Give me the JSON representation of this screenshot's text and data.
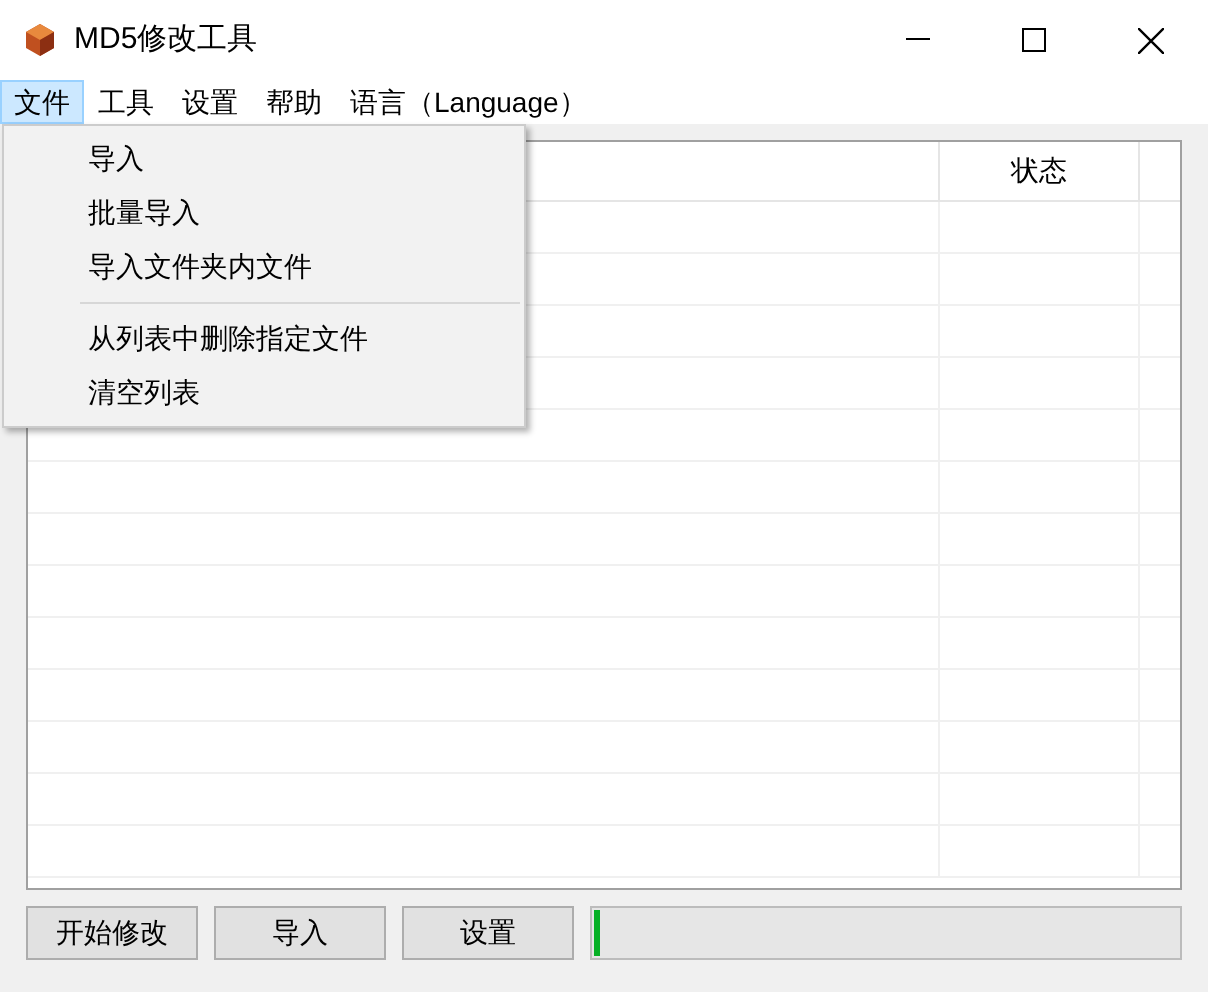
{
  "window": {
    "title": "MD5修改工具"
  },
  "menu_bar": [
    {
      "label": "文件",
      "selected": true
    },
    {
      "label": "工具",
      "selected": false
    },
    {
      "label": "设置",
      "selected": false
    },
    {
      "label": "帮助",
      "selected": false
    },
    {
      "label": "语言（Language）",
      "selected": false
    }
  ],
  "dropdown": [
    {
      "kind": "item",
      "label": "导入"
    },
    {
      "kind": "item",
      "label": "批量导入"
    },
    {
      "kind": "item",
      "label": "导入文件夹内文件"
    },
    {
      "kind": "separator"
    },
    {
      "kind": "item",
      "label": "从列表中删除指定文件"
    },
    {
      "kind": "item",
      "label": "清空列表"
    }
  ],
  "table": {
    "columns": [
      "状态"
    ]
  },
  "buttons": [
    "开始修改",
    "导入",
    "设置"
  ],
  "progress": {
    "level": 0.01
  }
}
